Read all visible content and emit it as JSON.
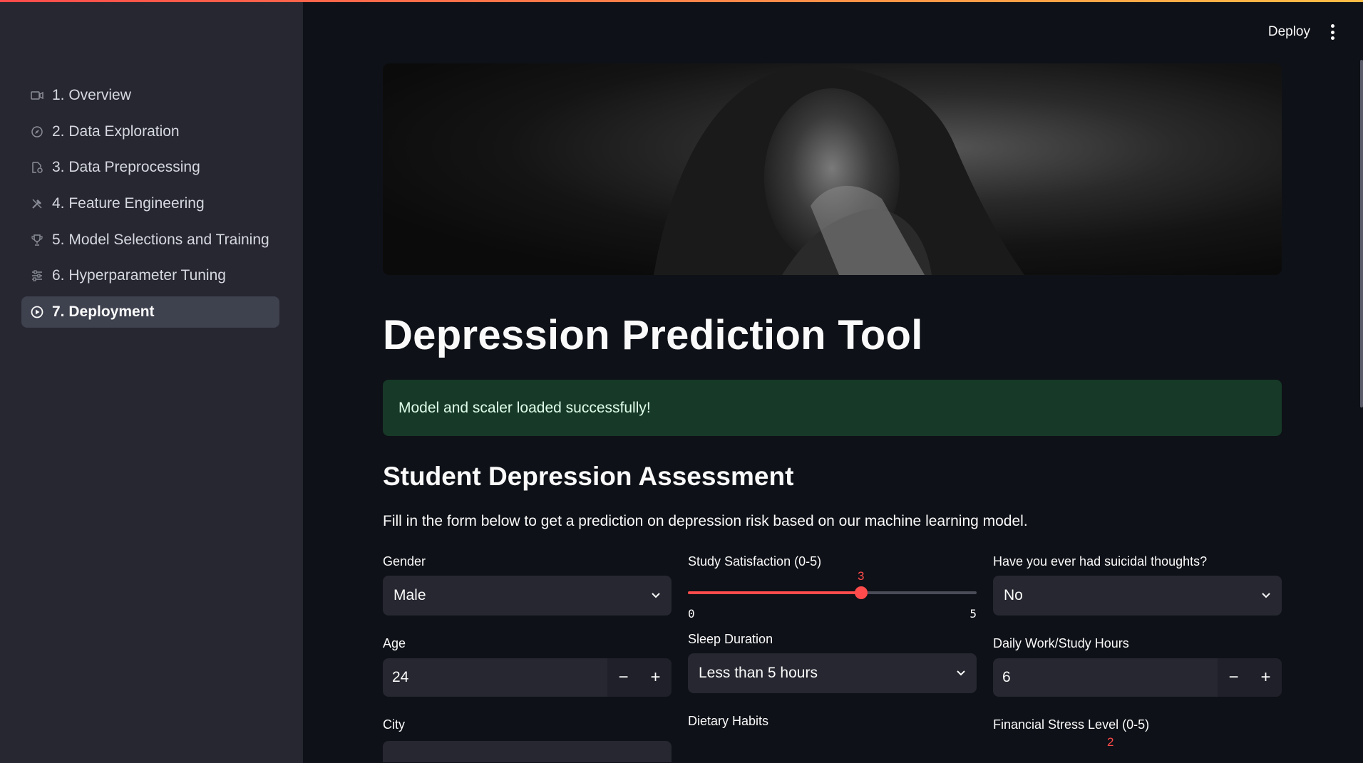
{
  "sidebar": {
    "items": [
      {
        "label": "1. Overview",
        "icon": "video-icon"
      },
      {
        "label": "2. Data Exploration",
        "icon": "explore-icon"
      },
      {
        "label": "3. Data Preprocessing",
        "icon": "preprocess-icon"
      },
      {
        "label": "4. Feature Engineering",
        "icon": "tools-icon"
      },
      {
        "label": "5. Model Selections and Training",
        "icon": "trophy-icon"
      },
      {
        "label": "6. Hyperparameter Tuning",
        "icon": "tune-icon"
      },
      {
        "label": "7. Deployment",
        "icon": "deploy-icon",
        "active": true
      }
    ]
  },
  "header": {
    "deploy_label": "Deploy"
  },
  "main": {
    "title": "Depression Prediction Tool",
    "alert": "Model and scaler loaded successfully!",
    "subtitle": "Student Depression Assessment",
    "description": "Fill in the form below to get a prediction on depression risk based on our machine learning model."
  },
  "form": {
    "gender": {
      "label": "Gender",
      "value": "Male"
    },
    "age": {
      "label": "Age",
      "value": "24"
    },
    "city": {
      "label": "City"
    },
    "study_satisfaction": {
      "label": "Study Satisfaction (0-5)",
      "value": "3",
      "min": "0",
      "max": "5",
      "fraction": 0.6
    },
    "sleep_duration": {
      "label": "Sleep Duration",
      "value": "Less than 5 hours"
    },
    "dietary_habits": {
      "label": "Dietary Habits"
    },
    "suicidal_thoughts": {
      "label": "Have you ever had suicidal thoughts?",
      "value": "No"
    },
    "work_hours": {
      "label": "Daily Work/Study Hours",
      "value": "6"
    },
    "financial_stress": {
      "label": "Financial Stress Level (0-5)",
      "value": "2"
    }
  },
  "colors": {
    "accent": "#ff4b4b",
    "success_bg": "#173928",
    "sidebar_bg": "#262730"
  }
}
